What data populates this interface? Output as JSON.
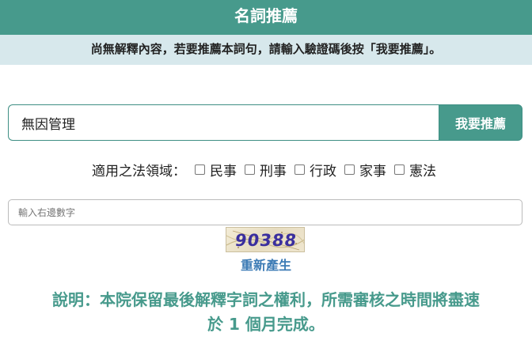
{
  "header": {
    "title": "名詞推薦"
  },
  "notice": {
    "text": "尚無解釋內容，若要推薦本詞句，請輸入驗證碼後按「我要推薦」。"
  },
  "recommend": {
    "term_value": "無因管理",
    "button_label": "我要推薦"
  },
  "domains": {
    "label": "適用之法領域：",
    "options": [
      {
        "label": "民事",
        "checked": false
      },
      {
        "label": "刑事",
        "checked": false
      },
      {
        "label": "行政",
        "checked": false
      },
      {
        "label": "家事",
        "checked": false
      },
      {
        "label": "憲法",
        "checked": false
      }
    ]
  },
  "captcha": {
    "placeholder": "輸入右邊數字",
    "code": "90388",
    "regenerate_label": "重新產生"
  },
  "explanation": {
    "line1": "說明：本院保留最後解釋字詞之權利，所需審核之時間將盡速",
    "line2": "於 1 個月完成。"
  },
  "colors": {
    "accent": "#479a8c",
    "notice_bg": "#d7e8ec",
    "link": "#3c7bb5"
  }
}
